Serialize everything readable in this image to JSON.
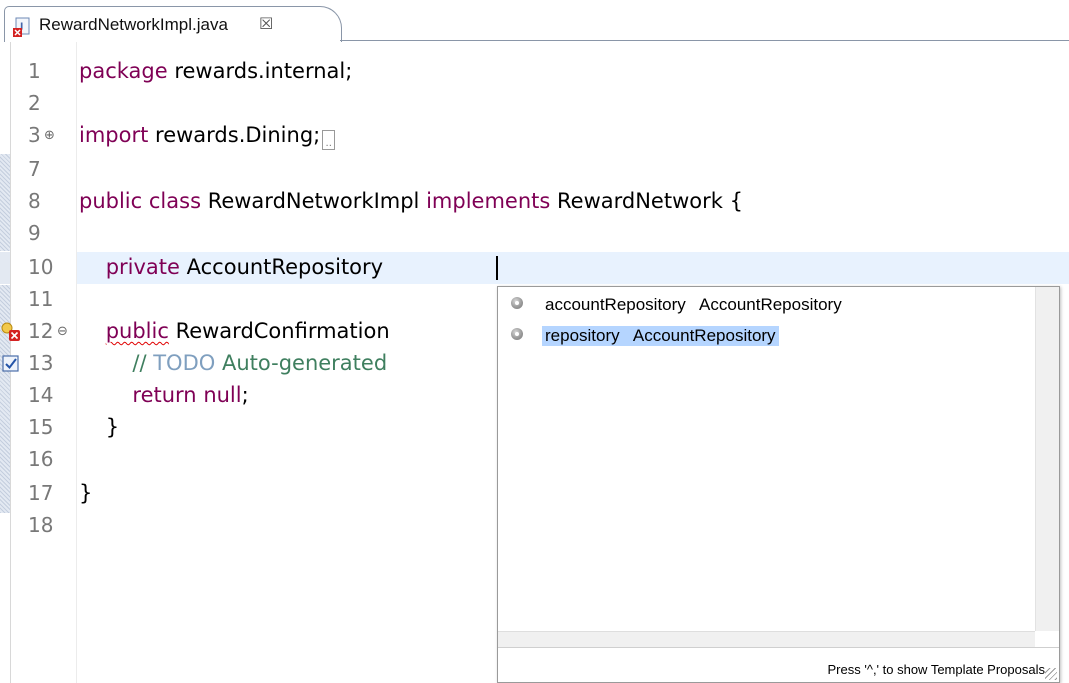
{
  "tab": {
    "title": "RewardNetworkImpl.java",
    "close_glyph": "☒",
    "icon": "java-file-error-icon"
  },
  "editor": {
    "lines": [
      {
        "num": "1"
      },
      {
        "num": "2"
      },
      {
        "num": "3"
      },
      {
        "num": "7"
      },
      {
        "num": "8"
      },
      {
        "num": "9"
      },
      {
        "num": "10"
      },
      {
        "num": "11"
      },
      {
        "num": "12"
      },
      {
        "num": "13"
      },
      {
        "num": "14"
      },
      {
        "num": "15"
      },
      {
        "num": "16"
      },
      {
        "num": "17"
      },
      {
        "num": "18"
      }
    ],
    "code": {
      "l1_kw": "package",
      "l1_rest": " rewards.internal;",
      "l3_kw": "import",
      "l3_rest": " rewards.Dining;",
      "l8_kw1": "public",
      "l8_kw2": "class",
      "l8_name": " RewardNetworkImpl ",
      "l8_kw3": "implements",
      "l8_rest": " RewardNetwork {",
      "l10_kw": "private",
      "l10_rest": " AccountRepository ",
      "l12_kw": "public",
      "l12_rest": " RewardConfirmation",
      "l13_slashes": "// ",
      "l13_todo": "TODO",
      "l13_rest": " Auto-generated",
      "l14_kw": "return",
      "l14_kw2": "null",
      "l14_rest": ";",
      "l15": "}",
      "l17": "}"
    },
    "fold_expand_glyph": "⊕",
    "fold_collapse_glyph": "⊖",
    "collapsed_glyph": ".."
  },
  "content_assist": {
    "proposals": [
      {
        "label": "accountRepository   AccountRepository",
        "selected": false
      },
      {
        "label": "repository   AccountRepository",
        "selected": true
      }
    ],
    "status": "Press '^,' to show Template Proposals"
  },
  "colors": {
    "keyword": "#7f0055",
    "comment": "#3f7f5f",
    "todo": "#7f9fbf",
    "current_line": "#e8f2fe",
    "selection": "#b5d5ff"
  }
}
